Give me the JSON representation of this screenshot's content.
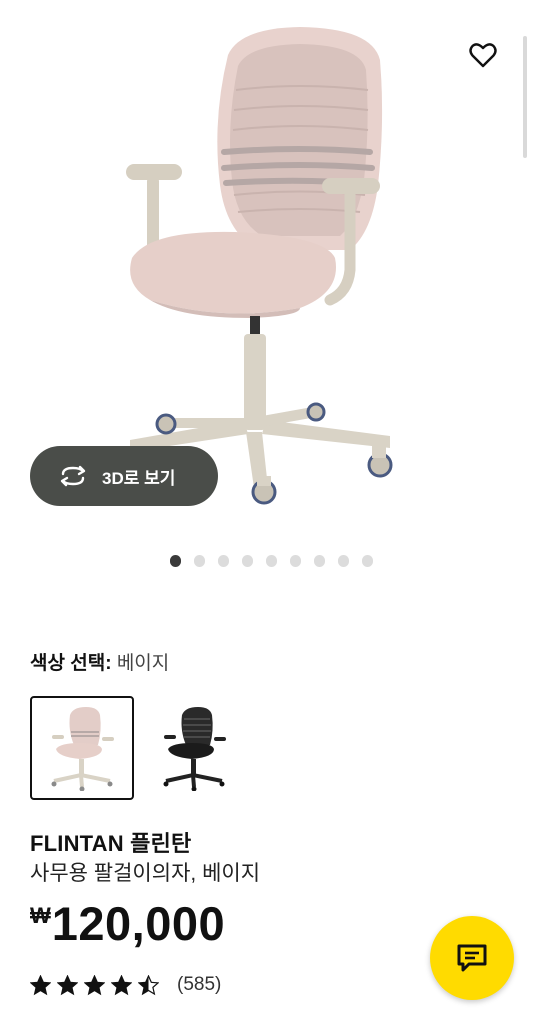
{
  "gallery": {
    "view_3d_label": "3D로 보기",
    "dots_total": 9,
    "active_index": 0
  },
  "product": {
    "color_label": "색상 선택:",
    "color_value": "베이지",
    "swatches": [
      {
        "color": "#e6cfc9",
        "selected": true
      },
      {
        "color": "#1b1b1b",
        "selected": false
      }
    ],
    "name": "FLINTAN 플린탄",
    "description": "사무용 팔걸이의자, 베이지",
    "currency": "₩",
    "price": "120,000",
    "rating_value": 4.5,
    "rating_count": "(585)"
  },
  "colors": {
    "accent_yellow": "#ffdb00",
    "pill_bg": "#4a4d49",
    "seat_beige": "#e6cfc9",
    "frame_beige": "#d9d3c6"
  },
  "icons": {
    "favorite": "heart-outline-icon",
    "rotate_3d": "rotate-3d-icon",
    "chat": "chat-bubble-icon",
    "rating": "star-icon"
  }
}
